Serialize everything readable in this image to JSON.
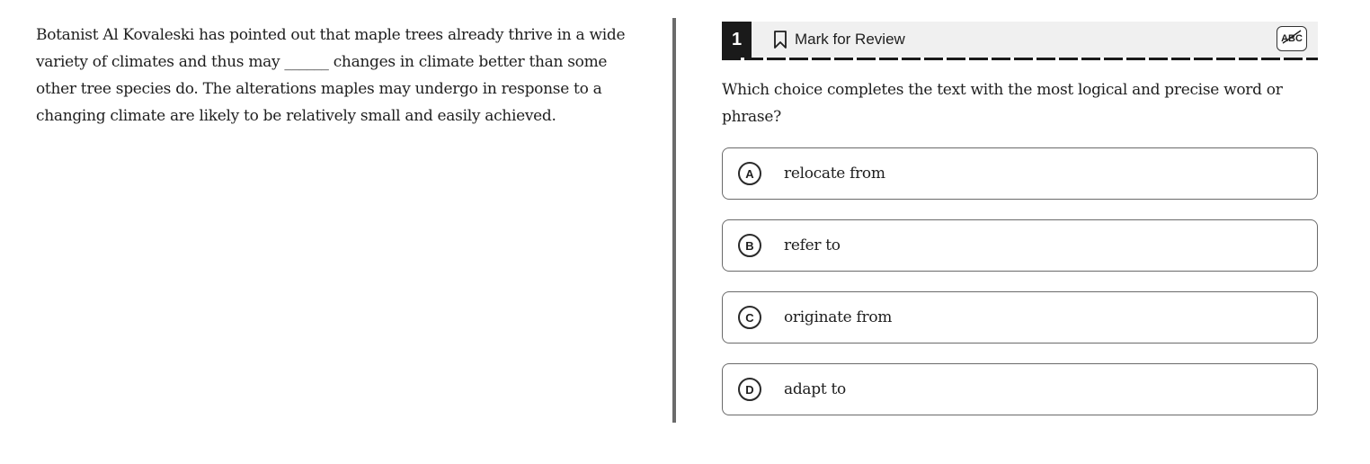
{
  "passage": {
    "text": "Botanist Al Kovaleski has pointed out that maple trees already thrive in a wide variety of climates and thus may ______ changes in climate better than some other tree species do. The alterations maples may undergo in response to a changing climate are likely to be relatively small and easily achieved."
  },
  "question": {
    "number": "1",
    "mark_for_review_label": "Mark for Review",
    "abc_tool_label": "ABC",
    "prompt": "Which choice completes the text with the most logical and precise word or phrase?",
    "options": [
      {
        "letter": "A",
        "text": "relocate from"
      },
      {
        "letter": "B",
        "text": "refer to"
      },
      {
        "letter": "C",
        "text": "originate from"
      },
      {
        "letter": "D",
        "text": "adapt to"
      }
    ]
  },
  "icons": {
    "bookmark": "bookmark-icon",
    "abc_strikethrough": "abc-strikethrough-icon"
  },
  "colors": {
    "divider": "#6b6b6b",
    "header_bg": "#f0f0f0",
    "number_bg": "#1a1a1a",
    "option_border": "#6a6a6a"
  }
}
